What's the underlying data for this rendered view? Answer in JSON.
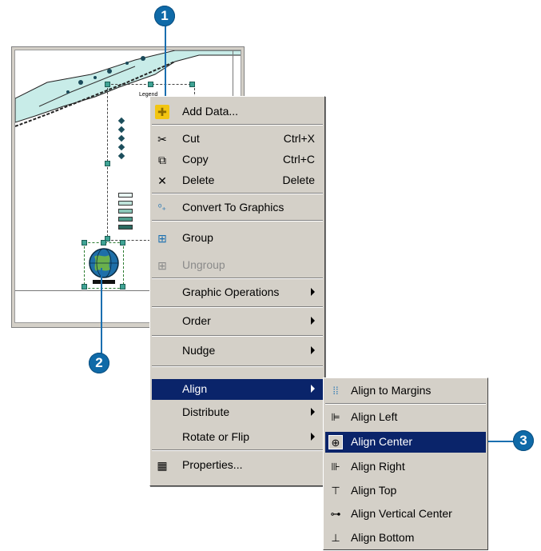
{
  "callouts": [
    "1",
    "2",
    "3"
  ],
  "map": {
    "legend_title": "Legend",
    "globe_label": "▀▀▀"
  },
  "menu": {
    "items": [
      {
        "label": "Add Data...",
        "icon": "add-data-icon",
        "glyph": "✚"
      },
      {
        "label": "Cut",
        "shortcut": "Ctrl+X",
        "icon": "scissors-icon",
        "glyph": "✂"
      },
      {
        "label": "Copy",
        "shortcut": "Ctrl+C",
        "icon": "copy-icon",
        "glyph": "⧉"
      },
      {
        "label": "Delete",
        "shortcut": "Delete",
        "icon": "delete-x-icon",
        "glyph": "✕"
      },
      {
        "label": "Convert To Graphics",
        "icon": "convert-graphics-icon",
        "glyph": "⁰₊"
      },
      {
        "label": "Group",
        "icon": "group-icon",
        "glyph": "⊞"
      },
      {
        "label": "Ungroup",
        "icon": "ungroup-icon",
        "glyph": "⊞"
      },
      {
        "label": "Graphic Operations"
      },
      {
        "label": "Order"
      },
      {
        "label": "Nudge"
      },
      {
        "label": "Align"
      },
      {
        "label": "Distribute"
      },
      {
        "label": "Rotate or Flip"
      },
      {
        "label": "Properties...",
        "icon": "properties-icon",
        "glyph": "▦"
      }
    ]
  },
  "submenu": {
    "items": [
      {
        "label": "Align to Margins",
        "icon": "align-margins-icon",
        "glyph": "⁞⁞"
      },
      {
        "label": "Align Left",
        "icon": "align-left-icon",
        "glyph": "⊫"
      },
      {
        "label": "Align Center",
        "icon": "align-center-icon",
        "glyph": "⊕"
      },
      {
        "label": "Align Right",
        "icon": "align-right-icon",
        "glyph": "⊪"
      },
      {
        "label": "Align Top",
        "icon": "align-top-icon",
        "glyph": "⊤"
      },
      {
        "label": "Align Vertical Center",
        "icon": "align-vcenter-icon",
        "glyph": "⊶"
      },
      {
        "label": "Align Bottom",
        "icon": "align-bottom-icon",
        "glyph": "⊥"
      }
    ]
  },
  "colors": {
    "menu_bg": "#d4d0c8",
    "highlight": "#0a246a",
    "callout": "#0f6aa8",
    "handle": "#3fa394"
  }
}
